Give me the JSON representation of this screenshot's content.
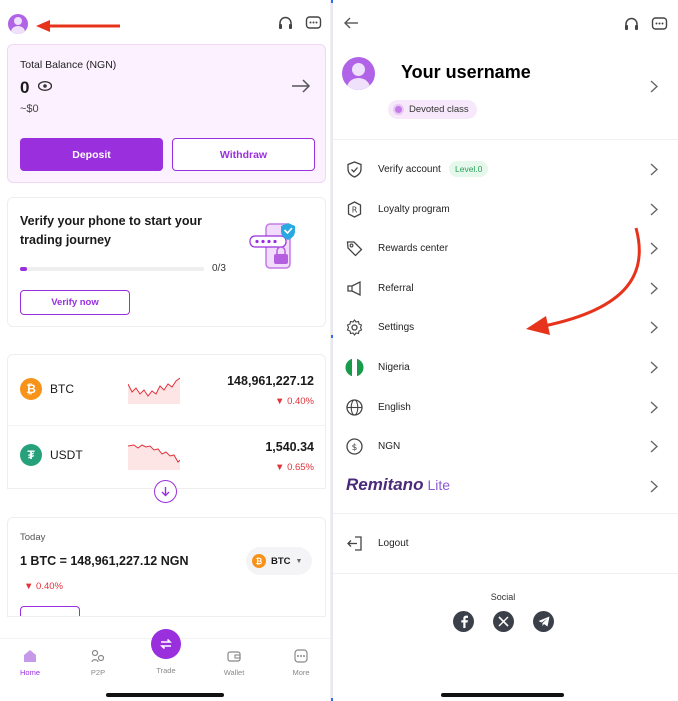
{
  "colors": {
    "accent": "#9a2fde",
    "negative": "#e2323a",
    "annotation_red": "#e8331c"
  },
  "left": {
    "balance": {
      "label": "Total Balance (NGN)",
      "amount": "0",
      "usd": "~$0",
      "deposit_label": "Deposit",
      "withdraw_label": "Withdraw"
    },
    "verify": {
      "title": "Verify your phone to start your trading journey",
      "progress_text": "0/3",
      "progress_fraction": 0.04,
      "button_label": "Verify now"
    },
    "markets": [
      {
        "symbol": "BTC",
        "icon": "bitcoin-icon",
        "price": "148,961,227.12",
        "change": "0.40%"
      },
      {
        "symbol": "USDT",
        "icon": "tether-icon",
        "price": "1,540.34",
        "change": "0.65%"
      }
    ],
    "today": {
      "label": "Today",
      "rate": "1 BTC = 148,961,227.12 NGN",
      "change": "0.40%",
      "selector": "BTC"
    },
    "nav": [
      {
        "label": "Home",
        "icon": "home-icon",
        "active": true
      },
      {
        "label": "P2P",
        "icon": "p2p-icon",
        "active": false
      },
      {
        "label": "Trade",
        "icon": "trade-icon",
        "active": false
      },
      {
        "label": "Wallet",
        "icon": "wallet-icon",
        "active": false
      },
      {
        "label": "More",
        "icon": "more-icon",
        "active": false
      }
    ]
  },
  "right": {
    "profile": {
      "username": "Your username",
      "class_badge": "Devoted class"
    },
    "menu": [
      {
        "label": "Verify account",
        "icon": "shield-check-icon",
        "badge": "Level.0"
      },
      {
        "label": "Loyalty program",
        "icon": "loyalty-icon"
      },
      {
        "label": "Rewards center",
        "icon": "tag-icon"
      },
      {
        "label": "Referral",
        "icon": "megaphone-icon"
      },
      {
        "label": "Settings",
        "icon": "gear-icon"
      },
      {
        "label": "Nigeria",
        "icon": "nigeria-flag-icon"
      },
      {
        "label": "English",
        "icon": "globe-icon"
      },
      {
        "label": "NGN",
        "icon": "currency-icon"
      }
    ],
    "remitano": {
      "brand": "Remitano",
      "suffix": "Lite"
    },
    "logout_label": "Logout",
    "social_label": "Social"
  }
}
